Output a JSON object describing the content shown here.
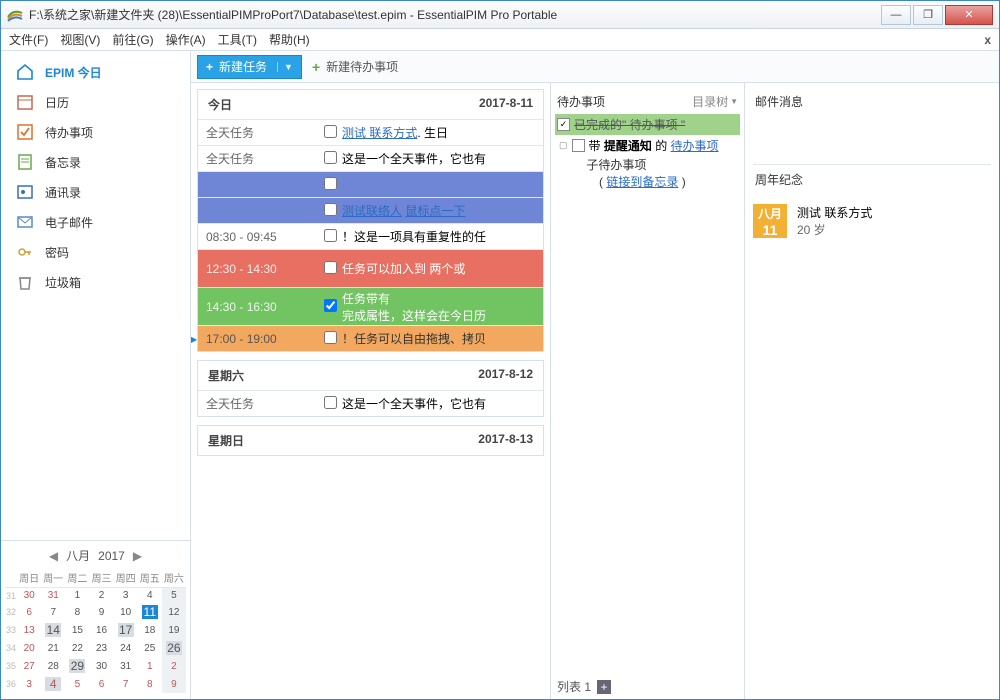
{
  "window": {
    "title": "F:\\系统之家\\新建文件夹 (28)\\EssentialPIMProPort7\\Database\\test.epim - EssentialPIM Pro Portable"
  },
  "menu": {
    "items": [
      "文件(F)",
      "视图(V)",
      "前往(G)",
      "操作(A)",
      "工具(T)",
      "帮助(H)"
    ]
  },
  "sidebar": {
    "items": [
      {
        "label": "EPIM 今日",
        "icon": "home-icon",
        "color": "#1a87d6"
      },
      {
        "label": "日历",
        "icon": "calendar-icon",
        "color": "#c46a52"
      },
      {
        "label": "待办事项",
        "icon": "todo-icon",
        "color": "#e0702a"
      },
      {
        "label": "备忘录",
        "icon": "note-icon",
        "color": "#6aa84f"
      },
      {
        "label": "通讯录",
        "icon": "contact-icon",
        "color": "#3a6fb0"
      },
      {
        "label": "电子邮件",
        "icon": "mail-icon",
        "color": "#5a8acb"
      },
      {
        "label": "密码",
        "icon": "key-icon",
        "color": "#d4a23a"
      },
      {
        "label": "垃圾箱",
        "icon": "trash-icon",
        "color": "#888"
      }
    ]
  },
  "toolbar": {
    "new_task": "新建任务",
    "new_todo": "新建待办事项"
  },
  "today": {
    "title": "今日",
    "date": "2017-8-11",
    "rows": [
      {
        "time": "全天任务",
        "desc_html": [
          "link:测试 联系方式",
          ". 生日"
        ],
        "bg": ""
      },
      {
        "time": "全天任务",
        "desc": "这是一个全天事件，它也有",
        "bg": ""
      },
      {
        "time": "",
        "desc": "",
        "bg": "blue"
      },
      {
        "time": "",
        "desc_html": [
          "link:测试联络人",
          "  ",
          "link:鼠标点一下"
        ],
        "bg": "blue"
      },
      {
        "time": "08:30 - 09:45",
        "desc": "！这是一项具有重复性的任",
        "bg": ""
      },
      {
        "time": "12:30 - 14:30",
        "desc": "任务可以加入到 两个或",
        "bg": "red"
      },
      {
        "time": "14:30 - 16:30",
        "checked": true,
        "desc": "任务带有\n完成属性，这样会在今日历",
        "bg": "green"
      },
      {
        "time": "17:00 - 19:00",
        "marker": true,
        "desc": "！任务可以自由拖拽、拷贝",
        "bg": "orange"
      }
    ]
  },
  "saturday": {
    "title": "星期六",
    "date": "2017-8-12",
    "rows": [
      {
        "time": "全天任务",
        "desc": "这是一个全天事件，它也有",
        "bg": ""
      }
    ]
  },
  "sunday": {
    "title": "星期日",
    "date": "2017-8-13"
  },
  "todo": {
    "title": "待办事项",
    "mode": "目录树",
    "items": {
      "done": "已完成的\" 待办事项 \"",
      "reminder_pre": "带 ",
      "reminder_bold": "提醒通知",
      "reminder_mid": " 的 ",
      "reminder_link": "待办事项",
      "child": "子待办事项",
      "child_link": "链接到备忘录"
    },
    "listbar": "列表 1"
  },
  "mail": {
    "title": "邮件消息"
  },
  "anniv": {
    "title": "周年纪念",
    "name": "测试 联系方式",
    "age": "20 岁"
  },
  "minical": {
    "month": "八月",
    "year": "2017",
    "dow": [
      "周日",
      "周一",
      "周二",
      "周三",
      "周四",
      "周五",
      "周六"
    ],
    "weeks": [
      {
        "wk": "31",
        "d": [
          {
            "n": "30",
            "c": "other"
          },
          {
            "n": "31",
            "c": "other"
          },
          {
            "n": "1"
          },
          {
            "n": "2"
          },
          {
            "n": "3"
          },
          {
            "n": "4"
          },
          {
            "n": "5",
            "c": "we"
          }
        ]
      },
      {
        "wk": "32",
        "d": [
          {
            "n": "6",
            "c": "other"
          },
          {
            "n": "7"
          },
          {
            "n": "8"
          },
          {
            "n": "9"
          },
          {
            "n": "10"
          },
          {
            "n": "11",
            "c": "today"
          },
          {
            "n": "12",
            "c": "we"
          }
        ]
      },
      {
        "wk": "33",
        "d": [
          {
            "n": "13",
            "c": "other"
          },
          {
            "n": "14",
            "c": "hl"
          },
          {
            "n": "15"
          },
          {
            "n": "16"
          },
          {
            "n": "17",
            "c": "hl"
          },
          {
            "n": "18"
          },
          {
            "n": "19",
            "c": "we"
          }
        ]
      },
      {
        "wk": "34",
        "d": [
          {
            "n": "20",
            "c": "other"
          },
          {
            "n": "21"
          },
          {
            "n": "22"
          },
          {
            "n": "23"
          },
          {
            "n": "24"
          },
          {
            "n": "25"
          },
          {
            "n": "26",
            "c": "we hl"
          }
        ]
      },
      {
        "wk": "35",
        "d": [
          {
            "n": "27",
            "c": "other"
          },
          {
            "n": "28"
          },
          {
            "n": "29",
            "c": "hl"
          },
          {
            "n": "30"
          },
          {
            "n": "31"
          },
          {
            "n": "1",
            "c": "other"
          },
          {
            "n": "2",
            "c": "other we"
          }
        ]
      },
      {
        "wk": "36",
        "d": [
          {
            "n": "3",
            "c": "other"
          },
          {
            "n": "4",
            "c": "other hl"
          },
          {
            "n": "5",
            "c": "other"
          },
          {
            "n": "6",
            "c": "other"
          },
          {
            "n": "7",
            "c": "other"
          },
          {
            "n": "8",
            "c": "other"
          },
          {
            "n": "9",
            "c": "other we"
          }
        ]
      }
    ]
  }
}
